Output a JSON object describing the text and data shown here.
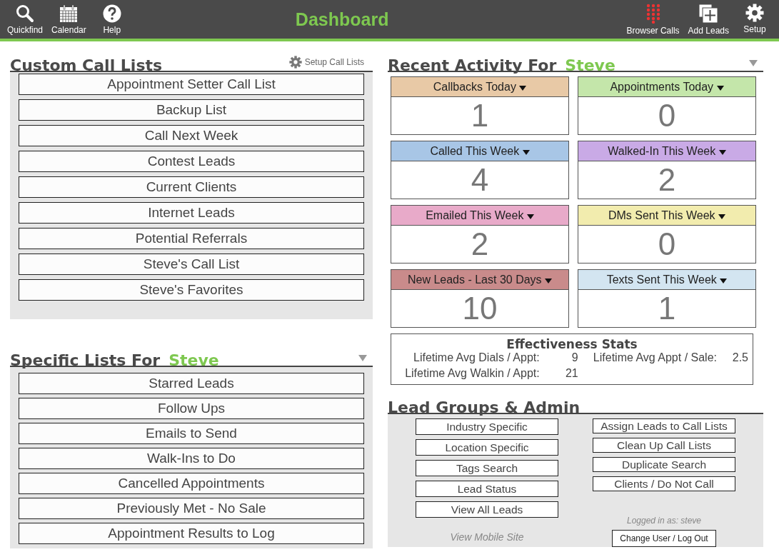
{
  "header": {
    "title": "Dashboard",
    "left_tools": [
      {
        "kind": "search",
        "label": "Quickfind"
      },
      {
        "kind": "calendar",
        "label": "Calendar"
      },
      {
        "kind": "help",
        "label": "Help"
      }
    ],
    "right_tools": [
      {
        "kind": "dialpad",
        "label": "Browser Calls"
      },
      {
        "kind": "add",
        "label": "Add Leads"
      },
      {
        "kind": "settings",
        "label": "Setup"
      }
    ]
  },
  "custom_call_lists": {
    "title": "Custom Call Lists",
    "setup_link": "Setup Call Lists",
    "items": [
      "Appointment Setter Call List",
      "Backup List",
      "Call Next Week",
      "Contest Leads",
      "Current Clients",
      "Internet Leads",
      "Potential Referrals",
      "Steve's Call List",
      "Steve's Favorites"
    ]
  },
  "specific_lists": {
    "title": "Specific Lists For",
    "user": "Steve",
    "items": [
      "Starred Leads",
      "Follow Ups",
      "Emails to Send",
      "Walk-Ins to Do",
      "Cancelled Appointments",
      "Previously Met - No Sale",
      "Appointment Results to Log"
    ]
  },
  "recent_activity": {
    "title": "Recent Activity For",
    "user": "Steve",
    "tiles": [
      {
        "label": "Callbacks Today",
        "count": "1",
        "color": "#e8c9a6"
      },
      {
        "label": "Appointments Today",
        "count": "0",
        "color": "#c4e6aa"
      },
      {
        "label": "Called This Week",
        "count": "4",
        "color": "#a8c6e6"
      },
      {
        "label": "Walked-In This Week",
        "count": "2",
        "color": "#c9aae6"
      },
      {
        "label": "Emailed This Week",
        "count": "2",
        "color": "#e8aac9"
      },
      {
        "label": "DMs Sent This Week",
        "count": "0",
        "color": "#f2ecae"
      },
      {
        "label": "New Leads - Last 30 Days",
        "count": "10",
        "color": "#c98b8b"
      },
      {
        "label": "Texts Sent This Week",
        "count": "1",
        "color": "#d3e5f1"
      }
    ]
  },
  "effectiveness_stats": {
    "title": "Effectiveness Stats",
    "stats": [
      {
        "label": "Lifetime Avg Dials / Appt:",
        "value": "9"
      },
      {
        "label": "Lifetime Avg Appt / Sale:",
        "value": "2.5"
      },
      {
        "label": "Lifetime Avg Walkin / Appt:",
        "value": "21"
      }
    ]
  },
  "lead_groups": {
    "title": "Lead Groups & Admin",
    "left_buttons": [
      "Industry Specific",
      "Location Specific",
      "Tags Search",
      "Lead Status",
      "View All Leads"
    ],
    "right_buttons": [
      "Assign Leads to Call Lists",
      "Clean Up Call Lists",
      "Duplicate Search",
      "Clients / Do Not Call"
    ],
    "mobile_link": "View Mobile Site",
    "logged_in": "Logged in as: steve",
    "logout_button": "Change User / Log Out"
  }
}
